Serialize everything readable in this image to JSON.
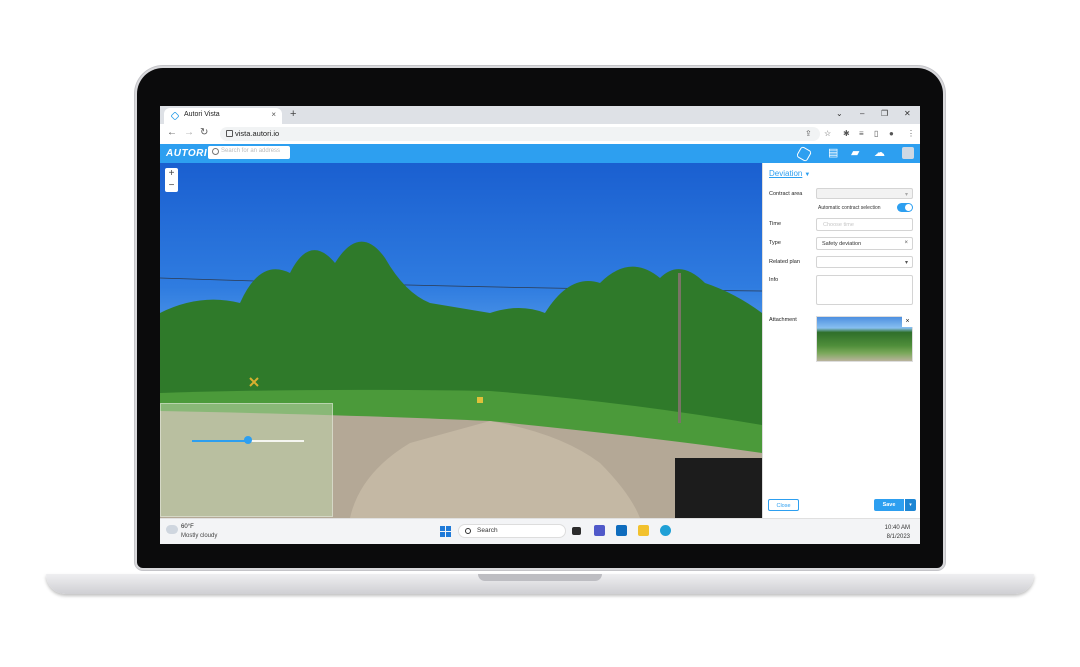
{
  "browser": {
    "tab_title": "Autori Vista",
    "tab_close": "×",
    "new_tab": "+",
    "url": "vista.autori.io",
    "window_controls": {
      "dropdown": "⌄",
      "minimize": "–",
      "restore": "❐",
      "close": "✕"
    },
    "nav": {
      "back": "←",
      "forward": "→",
      "reload": "↻"
    },
    "toolbar_icons": [
      "share-icon",
      "star-icon",
      "extensions-icon",
      "media-icon",
      "sidebar-icon",
      "profile-icon",
      "menu-icon"
    ]
  },
  "app": {
    "logo": "AUTORI",
    "search_placeholder": "Search for an address",
    "header_icons": [
      "autori-hex-icon",
      "clipboard-icon",
      "briefcase-icon",
      "cloud-upload-icon",
      "user-avatar-icon"
    ],
    "accent_color": "#2d9ff0"
  },
  "map": {
    "zoom_in": "+",
    "zoom_out": "−",
    "timeline_position": 0.5
  },
  "form": {
    "title": "Deviation",
    "contract_area": {
      "label": "Contract area",
      "value": ""
    },
    "auto_contract": {
      "label": "Automatic contract selection",
      "enabled": true
    },
    "time": {
      "label": "Time",
      "placeholder": "Choose time"
    },
    "type": {
      "label": "Type",
      "value": "Safety deviation",
      "clear": "×"
    },
    "related_plan": {
      "label": "Related plan",
      "value": ""
    },
    "info": {
      "label": "Info",
      "value": ""
    },
    "attachment": {
      "label": "Attachment",
      "remove": "×"
    },
    "close_button": "Close",
    "save_button": "Save"
  },
  "taskbar": {
    "weather_temp": "60°F",
    "weather_desc": "Mostly cloudy",
    "search_label": "Search",
    "apps": [
      "file-explorer-icon",
      "teams-icon",
      "outlook-icon",
      "folder-icon",
      "edge-icon"
    ],
    "time": "10:40 AM",
    "date": "8/1/2023"
  }
}
